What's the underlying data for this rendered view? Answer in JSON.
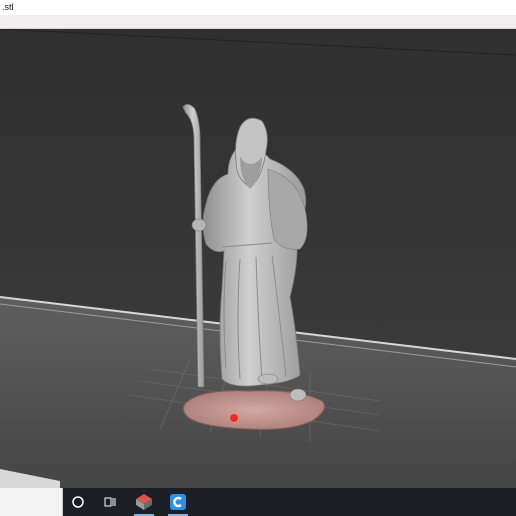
{
  "window": {
    "title": ".stl"
  },
  "taskbar": {
    "search_placeholder": "",
    "icons": [
      "cortana-circle-icon",
      "task-view-icon",
      "slicer-app-icon",
      "cura-app-icon"
    ],
    "accent": "#2f8fe0"
  },
  "colors": {
    "background": "#3a3a3a",
    "floor": "#5a5a5a",
    "model": "#b9b9b9",
    "base": "#c39a95",
    "marker": "#e0302a"
  }
}
